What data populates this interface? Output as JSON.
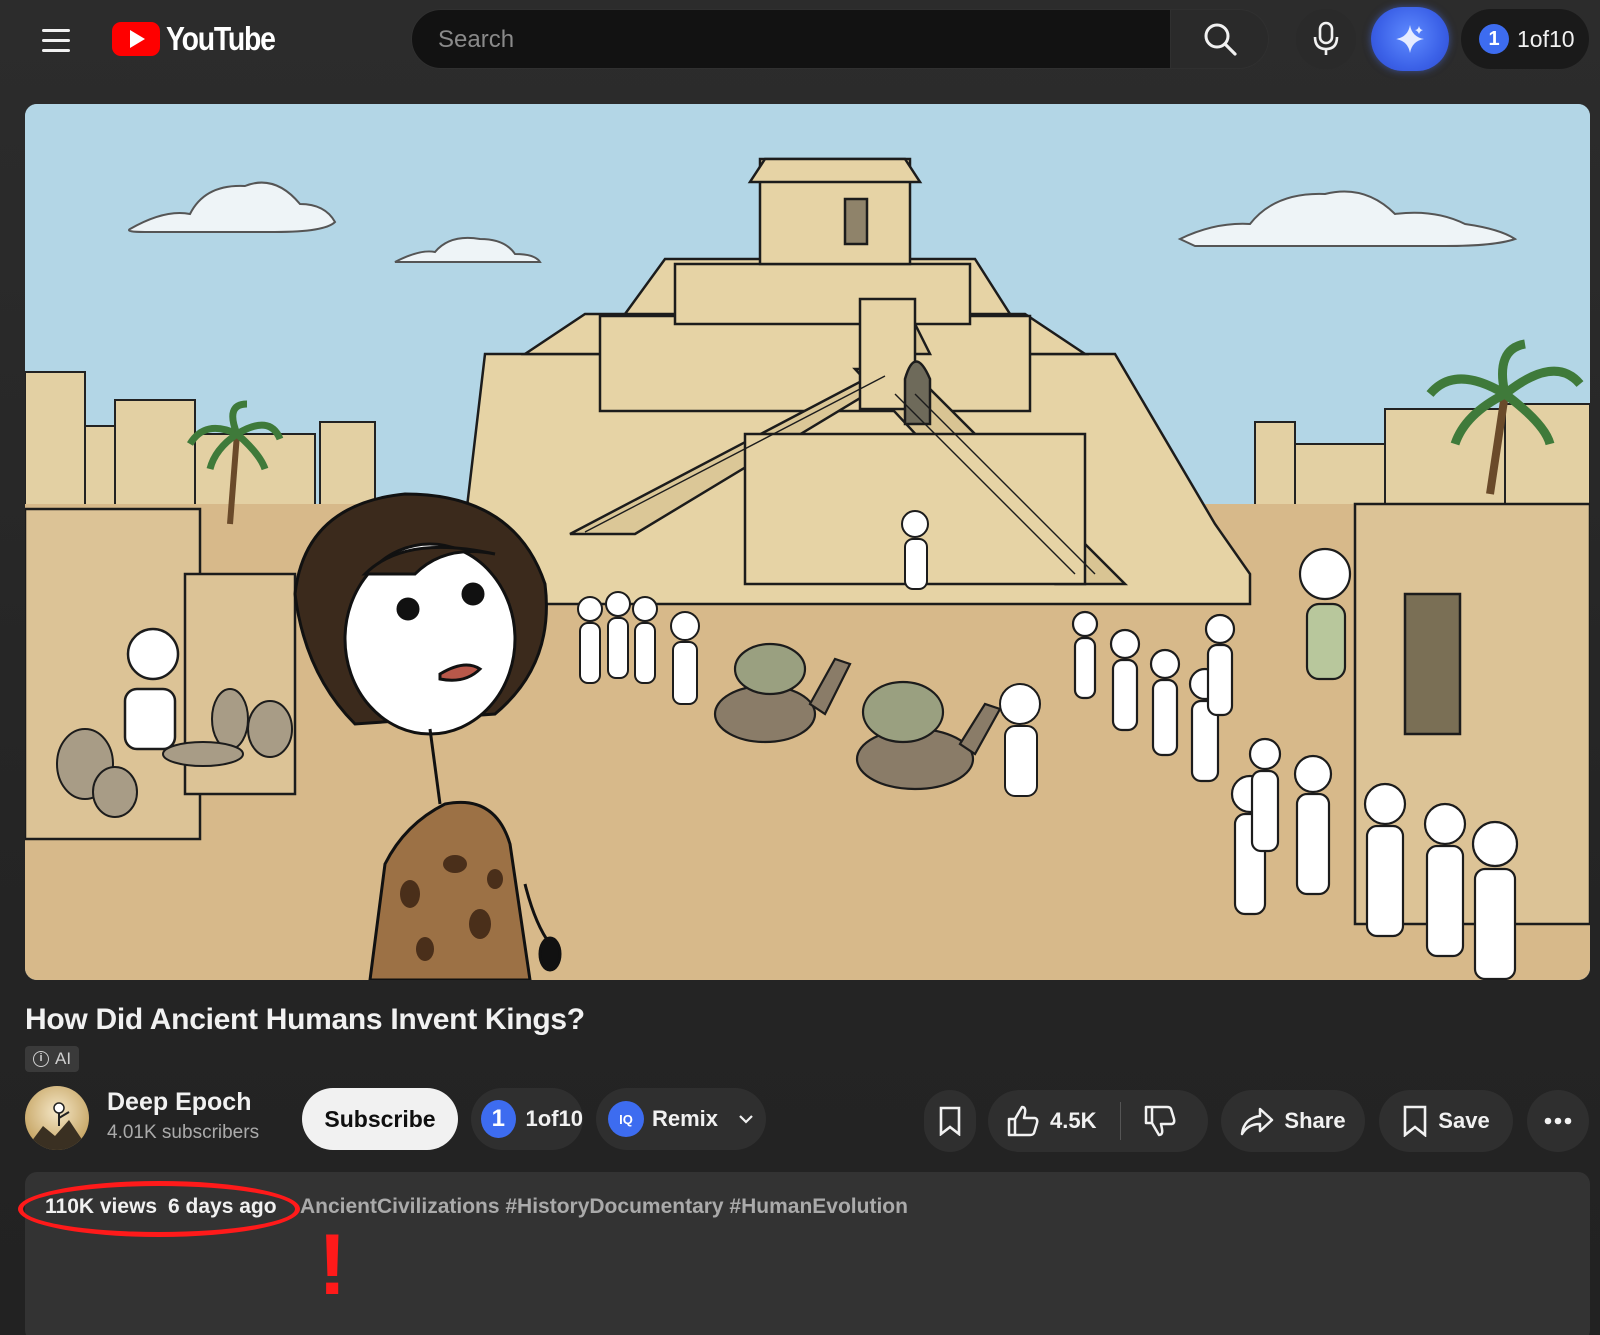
{
  "header": {
    "logo_text": "YouTube",
    "search_placeholder": "Search",
    "account_label": "1of10",
    "account_initial": "1"
  },
  "video": {
    "title": "How Did Ancient Humans Invent Kings?",
    "ai_badge": "AI"
  },
  "channel": {
    "name": "Deep Epoch",
    "subscribers": "4.01K subscribers",
    "subscribe_label": "Subscribe"
  },
  "actions": {
    "tool_1of10_label": "1of10",
    "tool_1of10_initial": "1",
    "remix_icon_text": "IQ",
    "remix_label": "Remix",
    "like_count": "4.5K",
    "share_label": "Share",
    "save_label": "Save"
  },
  "description": {
    "views": "110K views",
    "posted": "6 days ago",
    "tags": "AncientCivilizations #HistoryDocumentary #HumanEvolution"
  },
  "annotation": {
    "mark": "!"
  },
  "colors": {
    "brand_red": "#ff0000",
    "accent_blue": "#3d6cf0",
    "annotation_red": "#ff1a1a",
    "background": "#262626"
  }
}
